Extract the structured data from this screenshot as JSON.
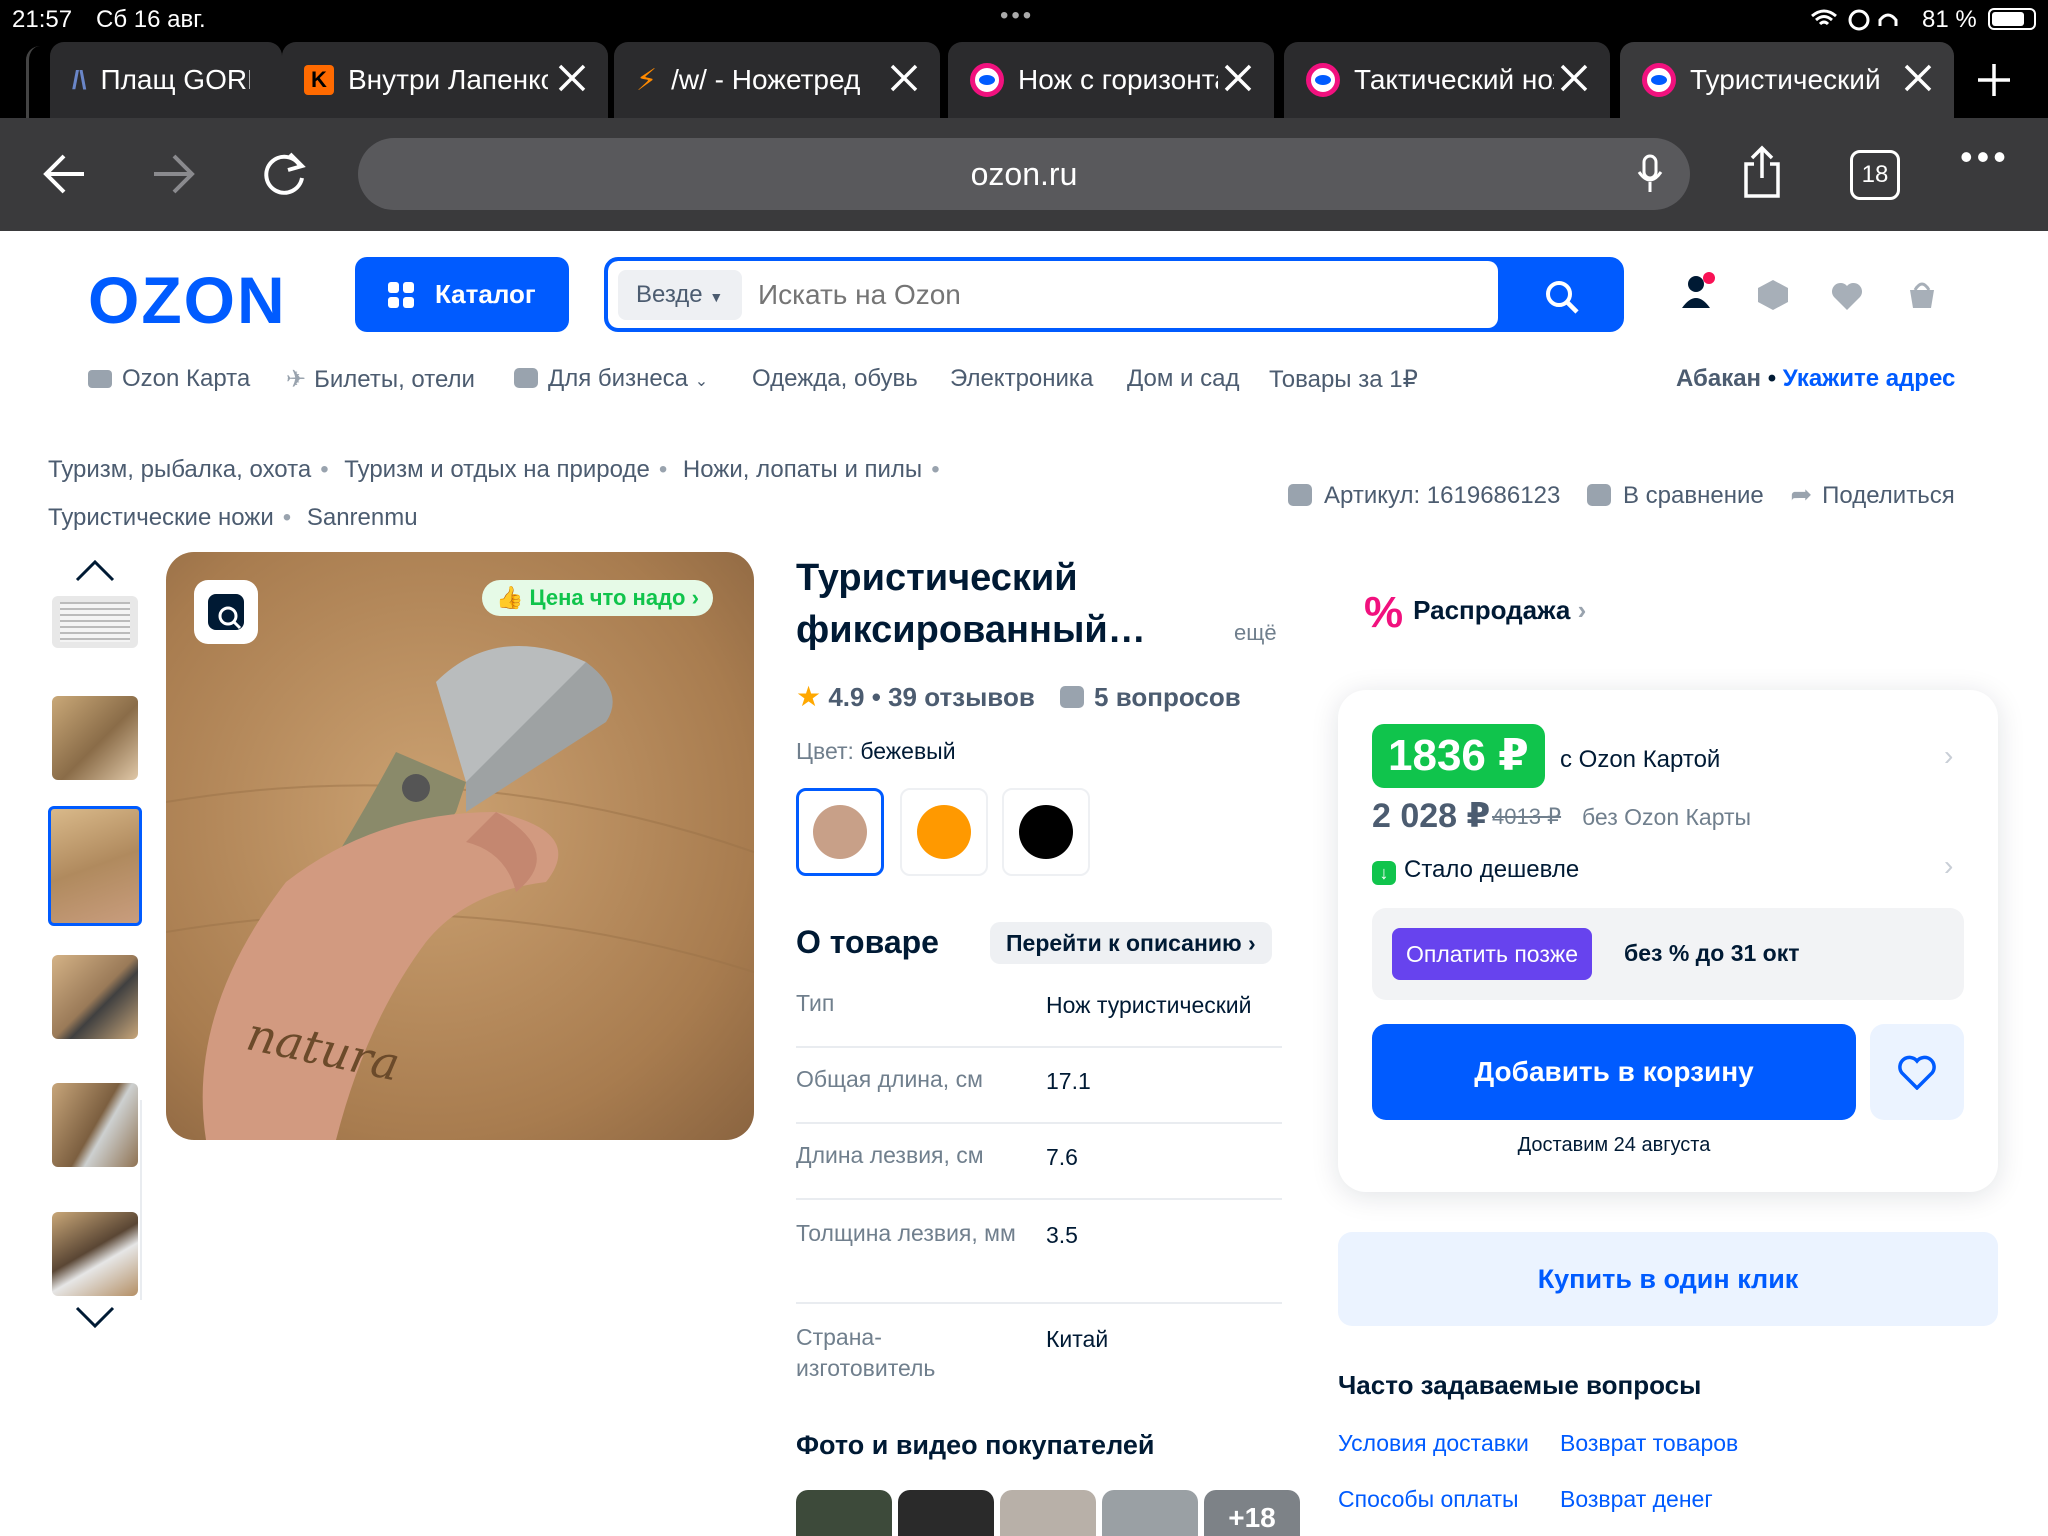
{
  "status": {
    "time": "21:57",
    "date": "Сб 16 авг.",
    "battery": "81 %"
  },
  "tabs": [
    {
      "title": "Плащ GORKA",
      "icon": "mountain-icon"
    },
    {
      "title": "Внутри Лапенко",
      "icon": "kinopoisk-icon"
    },
    {
      "title": "/w/ - Ножетред",
      "icon": "lightning-icon"
    },
    {
      "title": "Нож с горизонтальным",
      "icon": "ozon-icon"
    },
    {
      "title": "Тактический нож",
      "icon": "ozon-icon"
    },
    {
      "title": "Туристический",
      "icon": "ozon-icon"
    }
  ],
  "browser": {
    "url": "ozon.ru",
    "tab_count": "18"
  },
  "header": {
    "logo": "OZON",
    "catalog_label": "Каталог",
    "search_scope": "Везде",
    "search_placeholder": "Искать на Ozon"
  },
  "nav": {
    "items": [
      "Ozon Карта",
      "Билеты, отели",
      "Для бизнеса",
      "Одежда, обувь",
      "Электроника",
      "Дом и сад",
      "Товары за 1₽"
    ],
    "city": "Абакан",
    "address_link": "Укажите адрес"
  },
  "breadcrumbs": [
    "Туризм, рыбалка, охота",
    "Туризм и отдых на природе",
    "Ножи, лопаты и пилы",
    "Туристические ножи",
    "Sanrenmu"
  ],
  "meta": {
    "article": "Артикул: 1619686123",
    "compare": "В сравнение",
    "share": "Поделиться"
  },
  "gallery": {
    "badge": "Цена что надо",
    "watermark": "natura"
  },
  "product": {
    "title_line1": "Туристический",
    "title_line2": "фиксированный…",
    "more": "ещё",
    "rating": "4.9",
    "reviews": "39 отзывов",
    "questions": "5 вопросов",
    "color_label": "Цвет:",
    "color_value": "бежевый",
    "colors": [
      "#c8a088",
      "#ff9900",
      "#000000"
    ]
  },
  "about": {
    "title": "О товаре",
    "goto": "Перейти к описанию",
    "specs": [
      {
        "k": "Тип",
        "v": "Нож туристический"
      },
      {
        "k": "Общая длина, см",
        "v": "17.1"
      },
      {
        "k": "Длина лезвия, см",
        "v": "7.6"
      },
      {
        "k": "Толщина лезвия, мм",
        "v": "3.5"
      },
      {
        "k": "Страна-изготовитель",
        "v": "Китай"
      }
    ],
    "photos_title": "Фото и видео покупателей",
    "photos_more": "+18"
  },
  "sale": {
    "label": "Распродажа"
  },
  "buy": {
    "price_card": "1836 ₽",
    "price_card_caption": "с Ozon Картой",
    "price": "2 028 ₽",
    "price_old": "4013 ₽",
    "price_caption": "без Ozon Карты",
    "cheaper": "Стало дешевле",
    "pay_later": "Оплатить позже",
    "pay_later_caption": "без % до 31 окт",
    "add_to_cart": "Добавить в корзину",
    "delivery": "Доставим 24 августа",
    "one_click": "Купить в один клик"
  },
  "faq": {
    "title": "Часто задаваемые вопросы",
    "links": [
      "Условия доставки",
      "Возврат товаров",
      "Способы оплаты",
      "Возврат денег"
    ]
  }
}
